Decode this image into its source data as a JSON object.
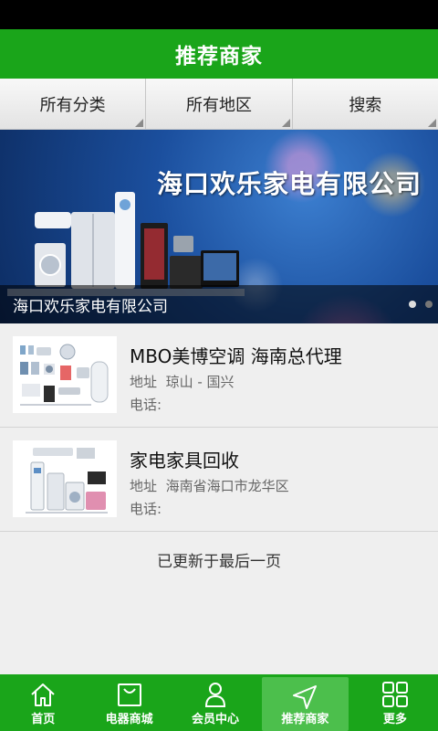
{
  "header": {
    "title": "推荐商家"
  },
  "filters": [
    {
      "label": "所有分类"
    },
    {
      "label": "所有地区"
    },
    {
      "label": "搜索"
    }
  ],
  "banner": {
    "headline": "海口欢乐家电有限公司",
    "caption": "海口欢乐家电有限公司",
    "slide_count": 2,
    "active_slide": 1
  },
  "merchants": [
    {
      "name": "MBO美博空调 海南总代理",
      "address_label": "地址",
      "address": "琼山 - 国兴",
      "phone_label": "电话:"
    },
    {
      "name": "家电家具回收",
      "address_label": "地址",
      "address": "海南省海口市龙华区",
      "phone_label": "电话:"
    }
  ],
  "list_end_text": "已更新于最后一页",
  "tabbar": {
    "tabs": [
      {
        "label": "首页",
        "icon": "home-icon"
      },
      {
        "label": "电器商城",
        "icon": "bag-icon"
      },
      {
        "label": "会员中心",
        "icon": "user-icon"
      },
      {
        "label": "推荐商家",
        "icon": "navigation-arrow-icon",
        "active": true
      },
      {
        "label": "更多",
        "icon": "grid-icon"
      }
    ]
  },
  "colors": {
    "primary_green": "#1aa51a",
    "active_tab": "#4cbf4c",
    "statusbar": "#000000"
  }
}
